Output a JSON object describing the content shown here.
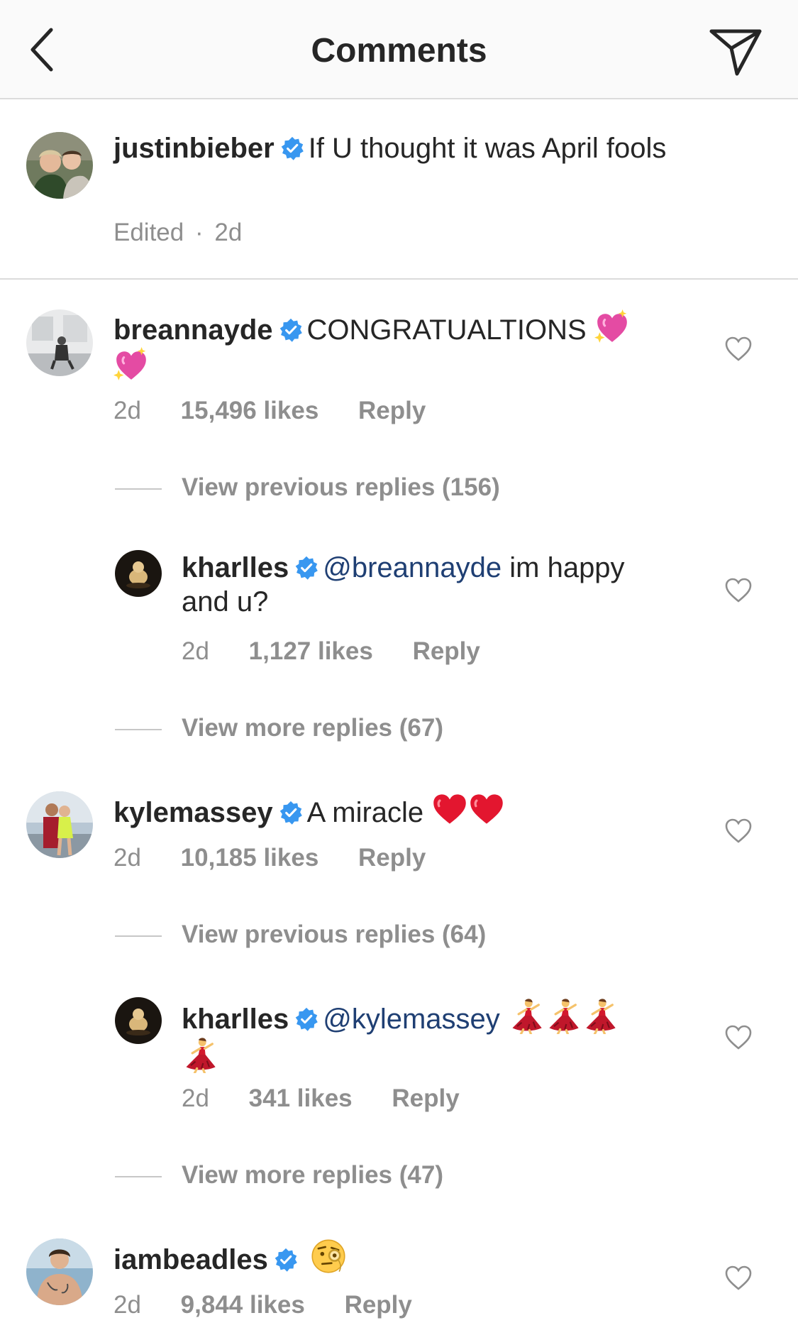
{
  "header": {
    "title": "Comments"
  },
  "caption": {
    "username": "justinbieber",
    "text": "If U thought it was April fools",
    "edited": "Edited",
    "separator": "·",
    "time": "2d"
  },
  "comments": [
    {
      "username": "breannayde",
      "text": "CONGRATUALTIONS",
      "emoji": "sparkling-heart",
      "time": "2d",
      "likes": "15,496 likes",
      "reply_label": "Reply",
      "view_previous": "View previous replies (156)",
      "reply": {
        "username": "kharlles",
        "mention": "@breannayde",
        "text": "im happy and u?",
        "time": "2d",
        "likes": "1,127 likes",
        "reply_label": "Reply"
      },
      "view_more": "View more replies (67)"
    },
    {
      "username": "kylemassey",
      "text": "A miracle",
      "emoji": "red-heart",
      "time": "2d",
      "likes": "10,185 likes",
      "reply_label": "Reply",
      "view_previous": "View previous replies (64)",
      "reply": {
        "username": "kharlles",
        "mention": "@kylemassey",
        "emoji": "dancer",
        "time": "2d",
        "likes": "341 likes",
        "reply_label": "Reply"
      },
      "view_more": "View more replies (47)"
    },
    {
      "username": "iambeadles",
      "emoji": "face-with-monocle",
      "time": "2d",
      "likes": "9,844 likes",
      "reply_label": "Reply"
    }
  ],
  "colors": {
    "header_bg": "#fafafa",
    "text": "#262626",
    "muted": "#8e8e8e",
    "verified_blue": "#3897f0",
    "mention": "#1f3f73",
    "divider": "#dbdbdb"
  }
}
